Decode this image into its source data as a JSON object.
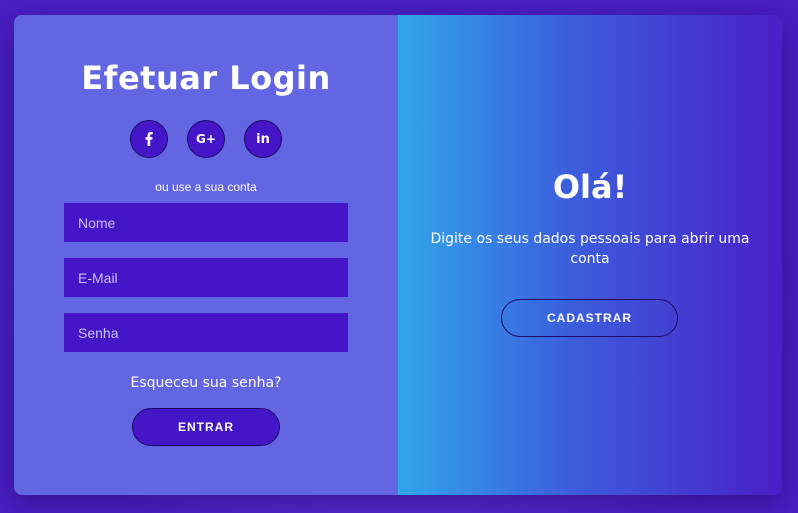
{
  "login": {
    "title": "Efetuar Login",
    "socials": [
      {
        "icon": "facebook-icon",
        "label": "f"
      },
      {
        "icon": "google-plus-icon",
        "label": "G+"
      },
      {
        "icon": "linkedin-icon",
        "label": "in"
      }
    ],
    "alt_text": "ou use a sua conta",
    "fields": {
      "nome_placeholder": "Nome",
      "email_placeholder": "E-Mail",
      "senha_placeholder": "Senha"
    },
    "forgot": "Esqueceu sua senha?",
    "submit_label": "ENTRAR"
  },
  "signup_panel": {
    "title": "Olá!",
    "text": "Digite os seus dados pessoais para abrir uma conta",
    "button_label": "CADASTRAR"
  },
  "colors": {
    "panel_left": "#6366e3",
    "accent": "#4416c8",
    "gradient_start": "#31a6ec",
    "gradient_end": "#4a1fc8"
  }
}
